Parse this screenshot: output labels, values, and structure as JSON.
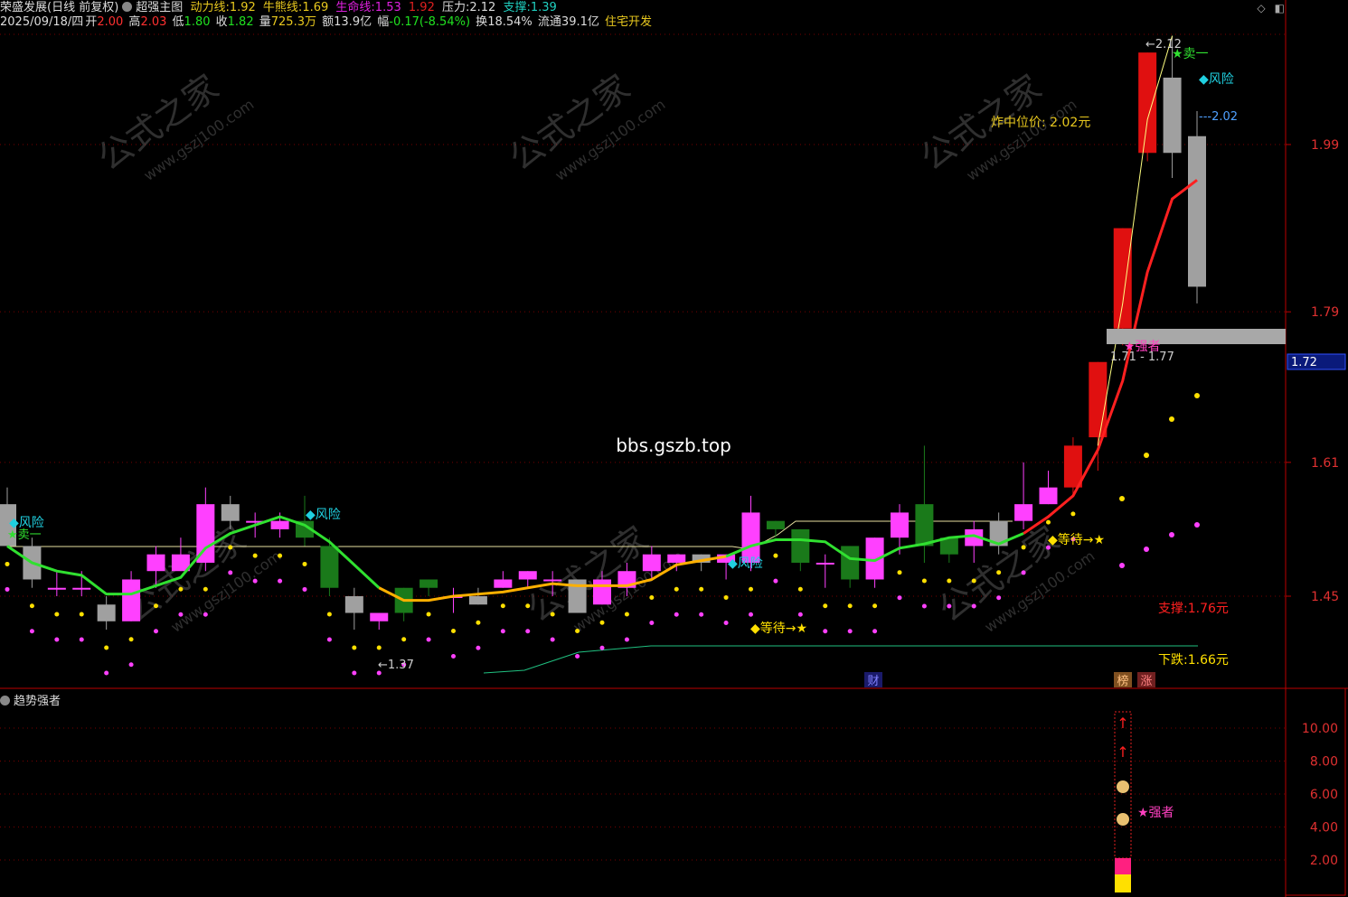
{
  "header": {
    "stock_name": "荣盛发展(日线 前复权)",
    "indicator_name": "超强主图",
    "dongli_label": "动力线:",
    "dongli_value": "1.92",
    "niuxiong_label": "牛熊线:",
    "niuxiong_value": "1.69",
    "shengming_label": "生命线:",
    "shengming_value": "1.53",
    "extra_value": "1.92",
    "yali_label": "压力:",
    "yali_value": "2.12",
    "zhicheng_label": "支撑:",
    "zhicheng_value": "1.39"
  },
  "quote": {
    "date": "2025/09/18/四",
    "open_label": "开",
    "open": "2.00",
    "high_label": "高",
    "high": "2.03",
    "low_label": "低",
    "low": "1.80",
    "close_label": "收",
    "close": "1.82",
    "volume_label": "量",
    "volume": "725.3万",
    "amount_label": "额",
    "amount": "13.9亿",
    "change_label": "幅",
    "change": "-0.17(-8.54%)",
    "turnover_label": "换",
    "turnover": "18.54%",
    "float_label": "流通",
    "float": "39.1亿",
    "industry": "住宅开发"
  },
  "price_axis": [
    "1.99",
    "1.79",
    "1.61",
    "1.45"
  ],
  "current_price_tag": "1.72",
  "indicator_axis": [
    "10.00",
    "8.00",
    "6.00",
    "4.00",
    "2.00"
  ],
  "annotations": {
    "risk": "◆风险",
    "sell": "★卖一",
    "wait": "◆等待→★",
    "low_mark": "←1.37",
    "high_mark": "←2.12",
    "mid_price": "炸中位价: 2.02元",
    "level_202": "---2.02",
    "strong": "★强者",
    "range": "1.71 - 1.77",
    "support": "支撑:1.76元",
    "down": "下跌:1.66元",
    "cai": "财",
    "bang": "榜",
    "zhang": "涨",
    "watermark_url": "www.gszj100.com",
    "watermark_text": "公式之家",
    "bbs": "bbs.gszb.top"
  },
  "sub_panel": {
    "title": "趋势强者",
    "strong": "★强者"
  },
  "candles": [
    {
      "o": 1.56,
      "c": 1.51,
      "h": 1.58,
      "l": 1.51
    },
    {
      "o": 1.51,
      "c": 1.47,
      "h": 1.52,
      "l": 1.46
    },
    {
      "o": 1.46,
      "c": 1.46,
      "h": 1.48,
      "l": 1.45
    },
    {
      "o": 1.46,
      "c": 1.46,
      "h": 1.48,
      "l": 1.45
    },
    {
      "o": 1.44,
      "c": 1.42,
      "h": 1.45,
      "l": 1.41
    },
    {
      "o": 1.42,
      "c": 1.47,
      "h": 1.48,
      "l": 1.42
    },
    {
      "o": 1.48,
      "c": 1.5,
      "h": 1.51,
      "l": 1.46
    },
    {
      "o": 1.48,
      "c": 1.5,
      "h": 1.52,
      "l": 1.48
    },
    {
      "o": 1.49,
      "c": 1.56,
      "h": 1.58,
      "l": 1.48
    },
    {
      "o": 1.56,
      "c": 1.54,
      "h": 1.57,
      "l": 1.53
    },
    {
      "o": 1.54,
      "c": 1.54,
      "h": 1.55,
      "l": 1.52
    },
    {
      "o": 1.53,
      "c": 1.54,
      "h": 1.55,
      "l": 1.52
    },
    {
      "o": 1.54,
      "c": 1.52,
      "h": 1.57,
      "l": 1.51
    },
    {
      "o": 1.51,
      "c": 1.46,
      "h": 1.52,
      "l": 1.45
    },
    {
      "o": 1.45,
      "c": 1.43,
      "h": 1.46,
      "l": 1.41
    },
    {
      "o": 1.42,
      "c": 1.43,
      "h": 1.43,
      "l": 1.41
    },
    {
      "o": 1.43,
      "c": 1.46,
      "h": 1.46,
      "l": 1.42
    },
    {
      "o": 1.47,
      "c": 1.46,
      "h": 1.47,
      "l": 1.45
    },
    {
      "o": 1.45,
      "c": 1.45,
      "h": 1.46,
      "l": 1.43
    },
    {
      "o": 1.45,
      "c": 1.44,
      "h": 1.46,
      "l": 1.44
    },
    {
      "o": 1.46,
      "c": 1.47,
      "h": 1.48,
      "l": 1.46
    },
    {
      "o": 1.47,
      "c": 1.48,
      "h": 1.48,
      "l": 1.46
    },
    {
      "o": 1.47,
      "c": 1.47,
      "h": 1.48,
      "l": 1.45
    },
    {
      "o": 1.47,
      "c": 1.43,
      "h": 1.47,
      "l": 1.43
    },
    {
      "o": 1.44,
      "c": 1.47,
      "h": 1.48,
      "l": 1.44
    },
    {
      "o": 1.46,
      "c": 1.48,
      "h": 1.49,
      "l": 1.45
    },
    {
      "o": 1.48,
      "c": 1.5,
      "h": 1.51,
      "l": 1.47
    },
    {
      "o": 1.49,
      "c": 1.5,
      "h": 1.5,
      "l": 1.48
    },
    {
      "o": 1.5,
      "c": 1.49,
      "h": 1.5,
      "l": 1.48
    },
    {
      "o": 1.49,
      "c": 1.5,
      "h": 1.5,
      "l": 1.47
    },
    {
      "o": 1.49,
      "c": 1.55,
      "h": 1.57,
      "l": 1.48
    },
    {
      "o": 1.54,
      "c": 1.53,
      "h": 1.54,
      "l": 1.52
    },
    {
      "o": 1.53,
      "c": 1.49,
      "h": 1.53,
      "l": 1.48
    },
    {
      "o": 1.49,
      "c": 1.49,
      "h": 1.5,
      "l": 1.46
    },
    {
      "o": 1.51,
      "c": 1.47,
      "h": 1.51,
      "l": 1.46
    },
    {
      "o": 1.47,
      "c": 1.52,
      "h": 1.52,
      "l": 1.46
    },
    {
      "o": 1.52,
      "c": 1.55,
      "h": 1.56,
      "l": 1.5
    },
    {
      "o": 1.56,
      "c": 1.51,
      "h": 1.63,
      "l": 1.49
    },
    {
      "o": 1.52,
      "c": 1.5,
      "h": 1.52,
      "l": 1.49
    },
    {
      "o": 1.51,
      "c": 1.53,
      "h": 1.54,
      "l": 1.49
    },
    {
      "o": 1.54,
      "c": 1.51,
      "h": 1.55,
      "l": 1.5
    },
    {
      "o": 1.54,
      "c": 1.56,
      "h": 1.61,
      "l": 1.53
    },
    {
      "o": 1.56,
      "c": 1.58,
      "h": 1.6,
      "l": 1.56
    },
    {
      "o": 1.58,
      "c": 1.63,
      "h": 1.64,
      "l": 1.57
    },
    {
      "o": 1.64,
      "c": 1.73,
      "h": 1.73,
      "l": 1.6
    },
    {
      "o": 1.77,
      "c": 1.89,
      "h": 1.89,
      "l": 1.75
    },
    {
      "o": 1.98,
      "c": 2.1,
      "h": 2.1,
      "l": 1.97
    },
    {
      "o": 2.07,
      "c": 1.98,
      "h": 2.12,
      "l": 1.95
    },
    {
      "o": 2.0,
      "c": 1.82,
      "h": 2.03,
      "l": 1.8
    }
  ]
}
